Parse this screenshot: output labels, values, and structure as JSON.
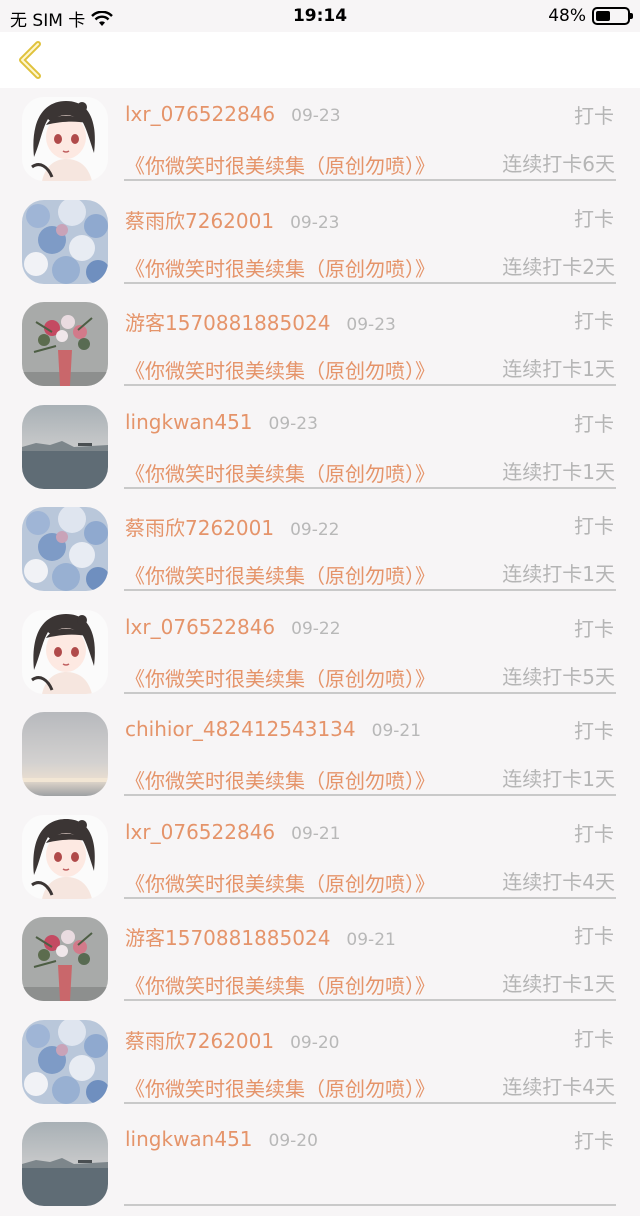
{
  "status_bar": {
    "carrier": "无 SIM 卡",
    "time": "19:14",
    "battery_text": "48%",
    "battery_level": 0.48
  },
  "nav": {
    "back_icon": "chevron-left-icon",
    "accent": "#e0c23c"
  },
  "rows": [
    {
      "user": "lxr_076522846",
      "date": "09-23",
      "action": "打卡",
      "title": "《你微笑时很美续集（原创勿喷）》",
      "streak": "连续打卡6天",
      "avatar": "anime-girl"
    },
    {
      "user": "蔡雨欣7262001",
      "date": "09-23",
      "action": "打卡",
      "title": "《你微笑时很美续集（原创勿喷）》",
      "streak": "连续打卡2天",
      "avatar": "blue-flowers"
    },
    {
      "user": "游客1570881885024",
      "date": "09-23",
      "action": "打卡",
      "title": "《你微笑时很美续集（原创勿喷）》",
      "streak": "连续打卡1天",
      "avatar": "flower-vase"
    },
    {
      "user": "lingkwan451",
      "date": "09-23",
      "action": "打卡",
      "title": "《你微笑时很美续集（原创勿喷）》",
      "streak": "连续打卡1天",
      "avatar": "sea"
    },
    {
      "user": "蔡雨欣7262001",
      "date": "09-22",
      "action": "打卡",
      "title": "《你微笑时很美续集（原创勿喷）》",
      "streak": "连续打卡1天",
      "avatar": "blue-flowers"
    },
    {
      "user": "lxr_076522846",
      "date": "09-22",
      "action": "打卡",
      "title": "《你微笑时很美续集（原创勿喷）》",
      "streak": "连续打卡5天",
      "avatar": "anime-girl"
    },
    {
      "user": "chihior_482412543134",
      "date": "09-21",
      "action": "打卡",
      "title": "《你微笑时很美续集（原创勿喷）》",
      "streak": "连续打卡1天",
      "avatar": "sky"
    },
    {
      "user": "lxr_076522846",
      "date": "09-21",
      "action": "打卡",
      "title": "《你微笑时很美续集（原创勿喷）》",
      "streak": "连续打卡4天",
      "avatar": "anime-girl"
    },
    {
      "user": "游客1570881885024",
      "date": "09-21",
      "action": "打卡",
      "title": "《你微笑时很美续集（原创勿喷）》",
      "streak": "连续打卡1天",
      "avatar": "flower-vase"
    },
    {
      "user": "蔡雨欣7262001",
      "date": "09-20",
      "action": "打卡",
      "title": "《你微笑时很美续集（原创勿喷）》",
      "streak": "连续打卡4天",
      "avatar": "blue-flowers"
    },
    {
      "user": "lingkwan451",
      "date": "09-20",
      "action": "打卡",
      "title": "",
      "streak": "",
      "avatar": "sea"
    }
  ]
}
